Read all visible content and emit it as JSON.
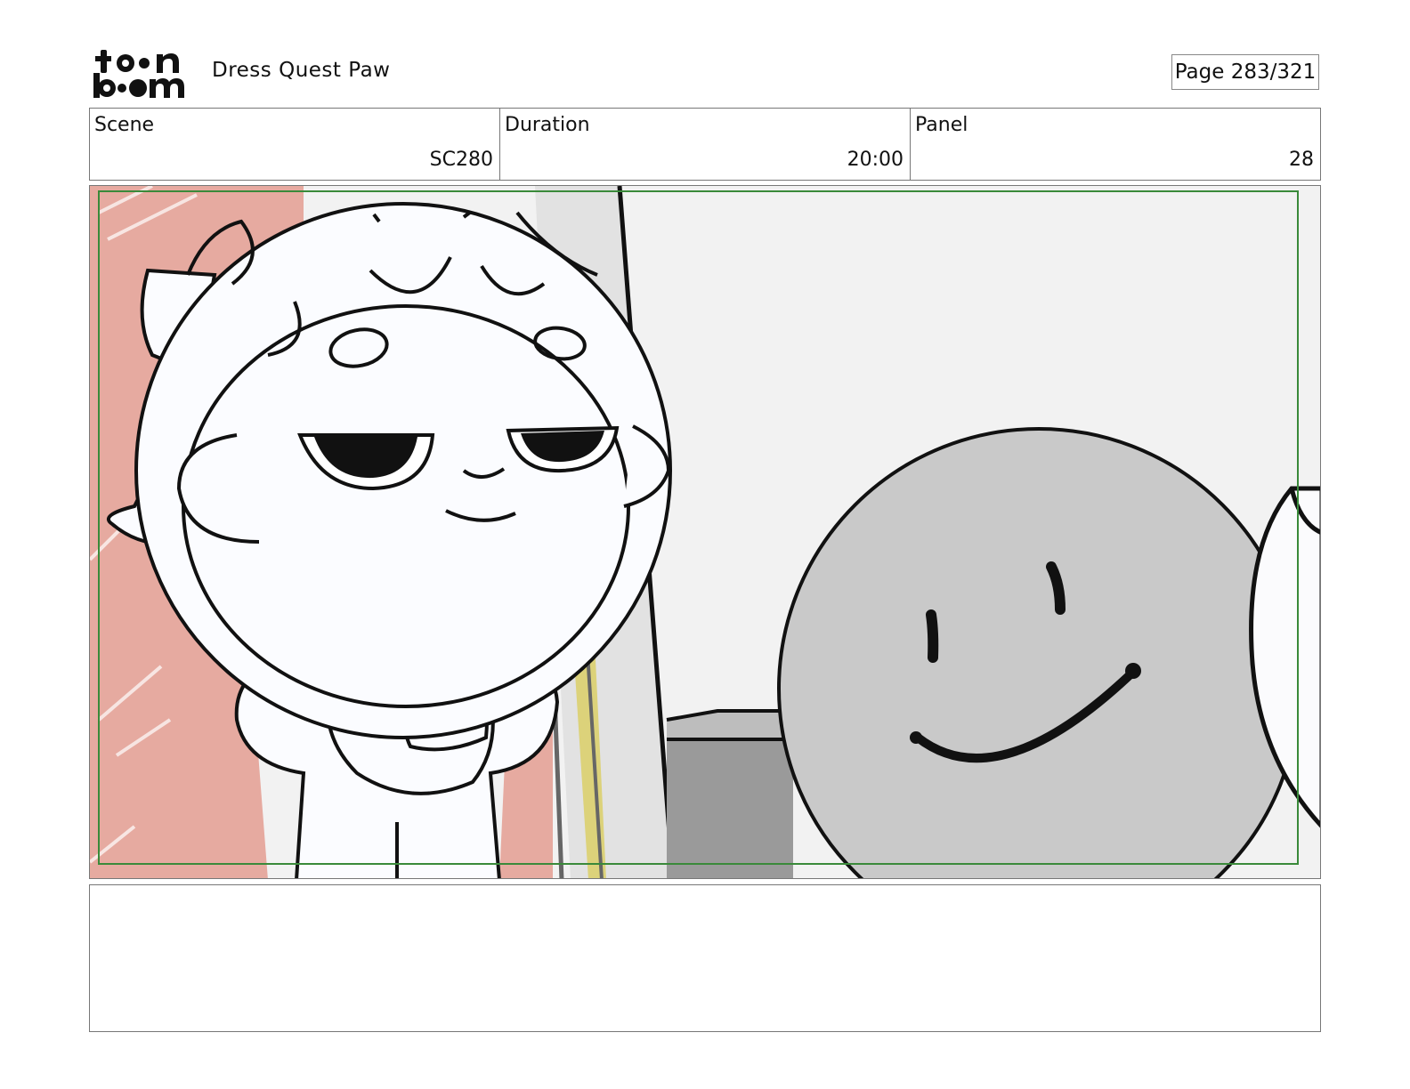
{
  "header": {
    "logo_line1": "toon",
    "logo_line2": "boom",
    "project_title": "Dress Quest Paw",
    "page_counter": "Page 283/321"
  },
  "info": {
    "scene_label": "Scene",
    "scene_value": "SC280",
    "duration_label": "Duration",
    "duration_value": "20:00",
    "panel_label": "Panel",
    "panel_value": "28"
  },
  "notes": {
    "text": ""
  }
}
